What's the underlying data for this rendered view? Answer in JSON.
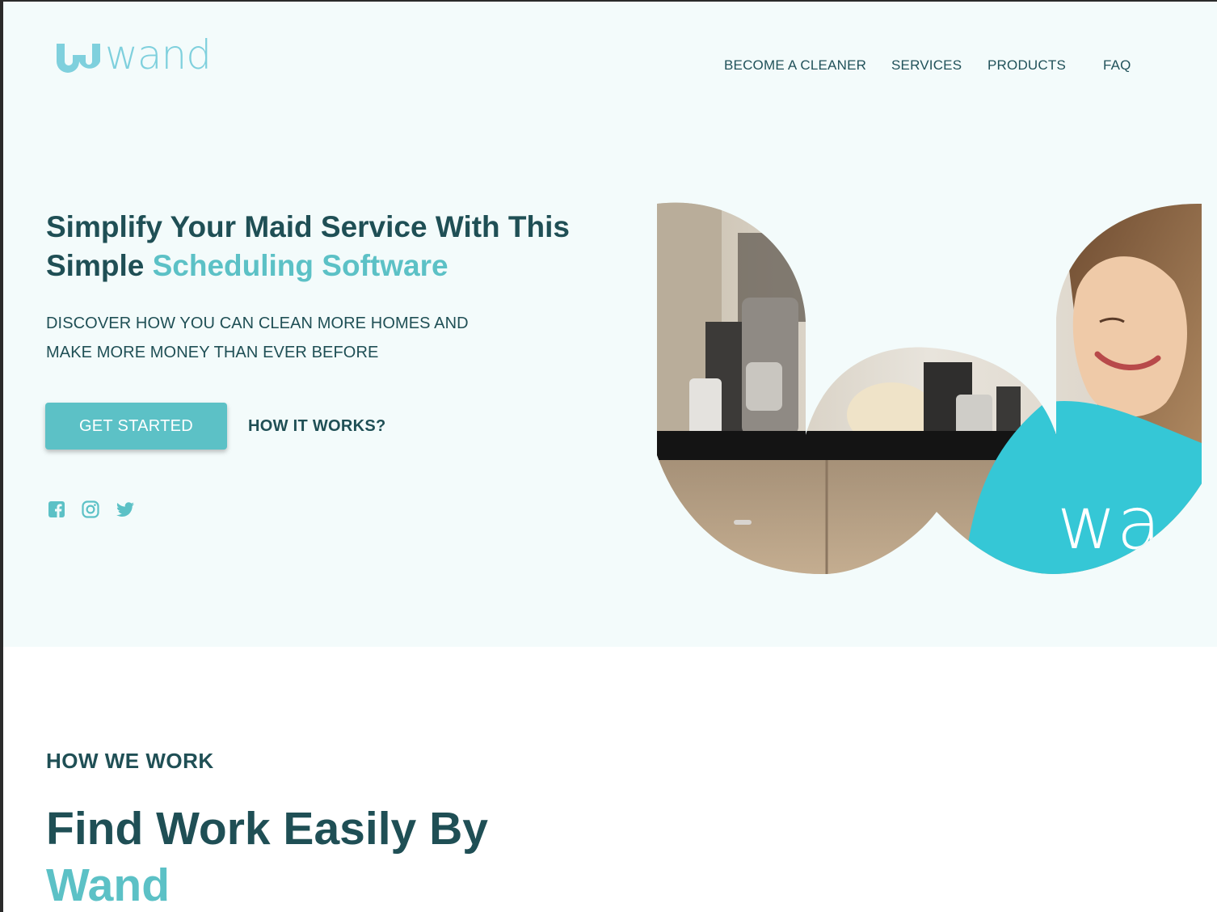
{
  "brand": {
    "name": "wand",
    "color": "#7fd0dd"
  },
  "nav": {
    "items": [
      "BECOME A CLEANER",
      "SERVICES",
      "PRODUCTS",
      "FAQ"
    ]
  },
  "hero": {
    "headline_part1": "Simplify Your Maid Service With This Simple ",
    "headline_accent": "Scheduling Software",
    "subcopy_line1": "DISCOVER HOW YOU CAN CLEAN MORE HOMES AND",
    "subcopy_line2": "MAKE MORE MONEY THAN EVER BEFORE",
    "primary_button": "GET STARTED",
    "secondary_link": "HOW IT WORKS?",
    "social_icons": [
      "facebook-icon",
      "instagram-icon",
      "twitter-icon"
    ],
    "photo_text": "wa"
  },
  "how_we_work": {
    "label": "HOW WE WORK",
    "title_part1": "Find Work Easily By",
    "title_accent": "Wand"
  },
  "colors": {
    "accent": "#5cc1c6",
    "text": "#1f4f55",
    "hero_bg": "#f3fbfb"
  }
}
